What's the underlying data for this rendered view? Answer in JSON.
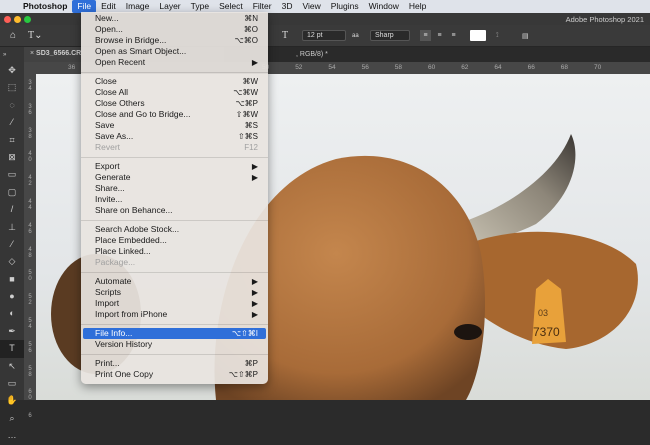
{
  "menubar": {
    "apple": "",
    "items": [
      "Photoshop",
      "File",
      "Edit",
      "Image",
      "Layer",
      "Type",
      "Select",
      "Filter",
      "3D",
      "View",
      "Plugins",
      "Window",
      "Help"
    ]
  },
  "window": {
    "title": "Adobe Photoshop 2021"
  },
  "options": {
    "font_size": "12 pt",
    "anti_alias": "Sharp",
    "color_swatch": "#ffffff"
  },
  "tabs": {
    "doc": "SD3_6566.CR",
    "doc_suffix": ", RGB/8) *"
  },
  "rulers": {
    "top": [
      "36",
      "50",
      "52",
      "54",
      "56",
      "58",
      "60",
      "62",
      "64",
      "66",
      "68",
      "70"
    ],
    "left": [
      "34",
      "36",
      "38",
      "40",
      "42",
      "44",
      "46",
      "48",
      "50",
      "52",
      "54",
      "56",
      "58",
      "60",
      "6"
    ]
  },
  "tools": [
    "move",
    "marquee",
    "lasso",
    "magic-wand",
    "crop",
    "frame",
    "ruler",
    "patch",
    "brush",
    "stamp",
    "history-brush",
    "eraser",
    "gradient",
    "blur",
    "dodge",
    "pen",
    "type",
    "path-select",
    "rectangle",
    "hand",
    "zoom",
    "more"
  ],
  "file_menu": [
    [
      {
        "label": "New...",
        "shortcut": "⌘N"
      },
      {
        "label": "Open...",
        "shortcut": "⌘O"
      },
      {
        "label": "Browse in Bridge...",
        "shortcut": "⌥⌘O"
      },
      {
        "label": "Open as Smart Object...",
        "shortcut": ""
      },
      {
        "label": "Open Recent",
        "shortcut": "▶"
      }
    ],
    [
      {
        "label": "Close",
        "shortcut": "⌘W"
      },
      {
        "label": "Close All",
        "shortcut": "⌥⌘W"
      },
      {
        "label": "Close Others",
        "shortcut": "⌥⌘P"
      },
      {
        "label": "Close and Go to Bridge...",
        "shortcut": "⇧⌘W"
      },
      {
        "label": "Save",
        "shortcut": "⌘S"
      },
      {
        "label": "Save As...",
        "shortcut": "⇧⌘S"
      },
      {
        "label": "Revert",
        "shortcut": "F12",
        "disabled": true
      }
    ],
    [
      {
        "label": "Export",
        "shortcut": "▶"
      },
      {
        "label": "Generate",
        "shortcut": "▶"
      },
      {
        "label": "Share...",
        "shortcut": ""
      },
      {
        "label": "Invite...",
        "shortcut": ""
      },
      {
        "label": "Share on Behance...",
        "shortcut": ""
      }
    ],
    [
      {
        "label": "Search Adobe Stock...",
        "shortcut": ""
      },
      {
        "label": "Place Embedded...",
        "shortcut": ""
      },
      {
        "label": "Place Linked...",
        "shortcut": ""
      },
      {
        "label": "Package...",
        "shortcut": "",
        "disabled": true
      }
    ],
    [
      {
        "label": "Automate",
        "shortcut": "▶"
      },
      {
        "label": "Scripts",
        "shortcut": "▶"
      },
      {
        "label": "Import",
        "shortcut": "▶"
      },
      {
        "label": "Import from iPhone",
        "shortcut": "▶"
      }
    ],
    [
      {
        "label": "File Info...",
        "shortcut": "⌥⇧⌘I",
        "highlighted": true
      },
      {
        "label": "Version History",
        "shortcut": ""
      }
    ],
    [
      {
        "label": "Print...",
        "shortcut": "⌘P"
      },
      {
        "label": "Print One Copy",
        "shortcut": "⌥⇧⌘P"
      }
    ]
  ],
  "ear_tag": {
    "top": "03",
    "number": "7370"
  },
  "colors": {
    "highlight": "#2f6fd9"
  }
}
